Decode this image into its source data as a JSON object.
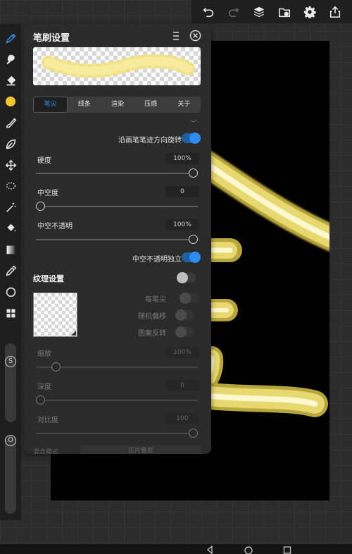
{
  "toolbar": {
    "undo_icon": "undo-icon",
    "redo_icon": "redo-icon",
    "layers_icon": "layers-icon",
    "gallery_icon": "gallery-icon",
    "settings_icon": "gear-icon",
    "share_icon": "share-icon"
  },
  "brush_panel": {
    "title": "笔刷设置",
    "tabs": [
      {
        "label": "笔尖",
        "active": true
      },
      {
        "label": "线条",
        "active": false
      },
      {
        "label": "渲染",
        "active": false
      },
      {
        "label": "压感",
        "active": false
      },
      {
        "label": "关于",
        "active": false
      }
    ],
    "rotate_along_stroke": {
      "label": "沿画笔笔迹方向旋转",
      "on": true
    },
    "hardness": {
      "label": "硬度",
      "value": "100%",
      "level": 1.0
    },
    "hollow": {
      "label": "中空度",
      "value": "0",
      "level": 0.0
    },
    "hollow_opacity": {
      "label": "中空不透明",
      "value": "100%",
      "level": 1.0
    },
    "hollow_opacity_independent": {
      "label": "中空不透明独立",
      "on": true
    },
    "texture": {
      "section_label": "纹理设置",
      "on": false,
      "per_tip": {
        "label": "每笔尖"
      },
      "random_offset": {
        "label": "随机偏移"
      },
      "pattern_invert": {
        "label": "图案反转"
      },
      "scale": {
        "label": "缩放",
        "value": "100%",
        "level": 0.1
      },
      "depth": {
        "label": "深度",
        "value": "0",
        "level": 0.0
      },
      "contrast": {
        "label": "对比度",
        "value": "100",
        "level": 1.0
      }
    },
    "blend_mode": {
      "label": "混合模式",
      "value": "正片叠底"
    }
  },
  "colors": {
    "accent": "#2d8cf0",
    "current_color": "#f4c430",
    "canvas": "#000000",
    "stroke_gold": "#e8d870"
  },
  "tools": [
    "brush-icon",
    "smudge-icon",
    "eraser-icon",
    "color-icon",
    "brush-library-icon",
    "leaf-icon",
    "move-icon",
    "lasso-icon",
    "magic-wand-icon",
    "fill-icon",
    "gradient-icon",
    "eyedropper-icon",
    "circle-icon",
    "grid-icon"
  ],
  "size_slider_label": "S",
  "opacity_slider_label": "O"
}
